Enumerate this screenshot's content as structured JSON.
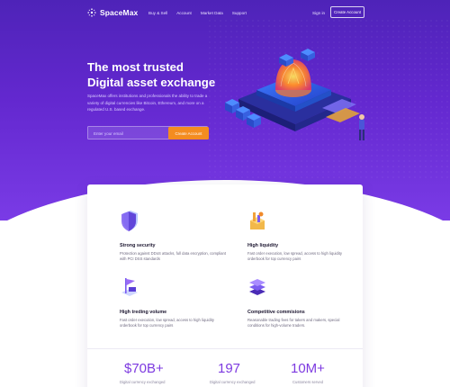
{
  "brand": {
    "name": "SpaceMax"
  },
  "nav": {
    "links": [
      "Buy & Sell",
      "Account",
      "Market Data",
      "Support"
    ],
    "signin": "Sign in",
    "create_account": "Create Account"
  },
  "hero": {
    "title_line1": "The most trusted",
    "title_line2": "Digital asset exchange",
    "description": "SpaceMax offers institutions and professionals the ability to trade a variety of digital currencies like Bitcoin, Ethereum, and more on a regulated U.S. based exchange.",
    "email_placeholder": "Enter your email",
    "cta": "Create Account"
  },
  "features": [
    {
      "title": "Strong security",
      "description": "Protection against DDoS attacks, full data encryption, compliant with PCI DSS standards",
      "icon": "shield-icon"
    },
    {
      "title": "High liquidity",
      "description": "Fast order execution, low spread, access to high liquidity orderbook for top currency pairs",
      "icon": "coins-icon"
    },
    {
      "title": "High treding volume",
      "description": "Fast order execution, low spread, access to high liquidity orderbook for top currency pairs",
      "icon": "flag-icon"
    },
    {
      "title": "Competitive commisions",
      "description": "Reasonable trading fees for takers and makers, special conditions for high-volume traders.",
      "icon": "layers-icon"
    }
  ],
  "stats": [
    {
      "value": "$70B+",
      "label": "Digital currency exchanged"
    },
    {
      "value": "197",
      "label": "Digital currency exchanged"
    },
    {
      "value": "10M+",
      "label": "Customers served"
    }
  ],
  "colors": {
    "accent": "#7d3ae0",
    "cta": "#f48c20",
    "hero_top": "#4e23b8",
    "hero_bottom": "#7a3be6"
  }
}
